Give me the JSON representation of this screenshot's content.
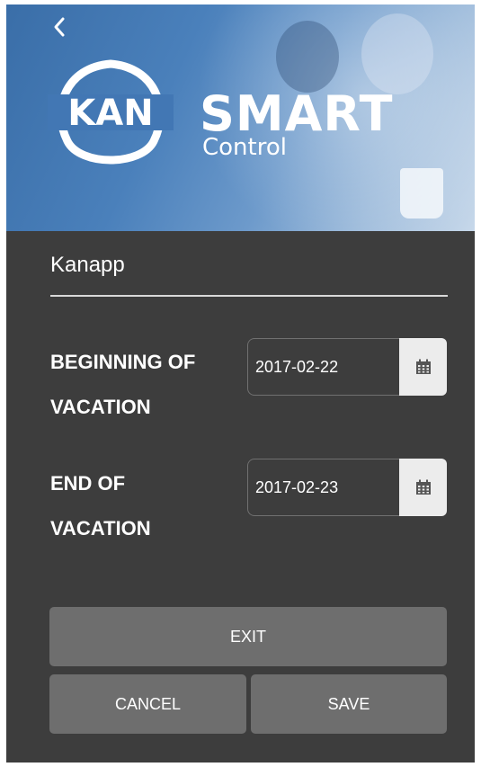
{
  "header": {
    "back_icon": "chevron-left-icon",
    "brand_main": "SMART",
    "brand_sub": "Control",
    "logo_text": "KAN"
  },
  "app": {
    "title": "Kanapp"
  },
  "vacation": {
    "beginning": {
      "label_line1": "BEGINNING OF",
      "label_line2": "VACATION",
      "value": "2017-02-22",
      "icon": "calendar-icon"
    },
    "end": {
      "label_line1": "END OF",
      "label_line2": "VACATION",
      "value": "2017-02-23",
      "icon": "calendar-icon"
    }
  },
  "actions": {
    "exit_label": "EXIT",
    "cancel_label": "CANCEL",
    "save_label": "SAVE"
  },
  "colors": {
    "background": "#3d3d3d",
    "button": "#6e6e6e",
    "hero_blue": "#4a80bb",
    "calendar_button": "#ececec"
  }
}
